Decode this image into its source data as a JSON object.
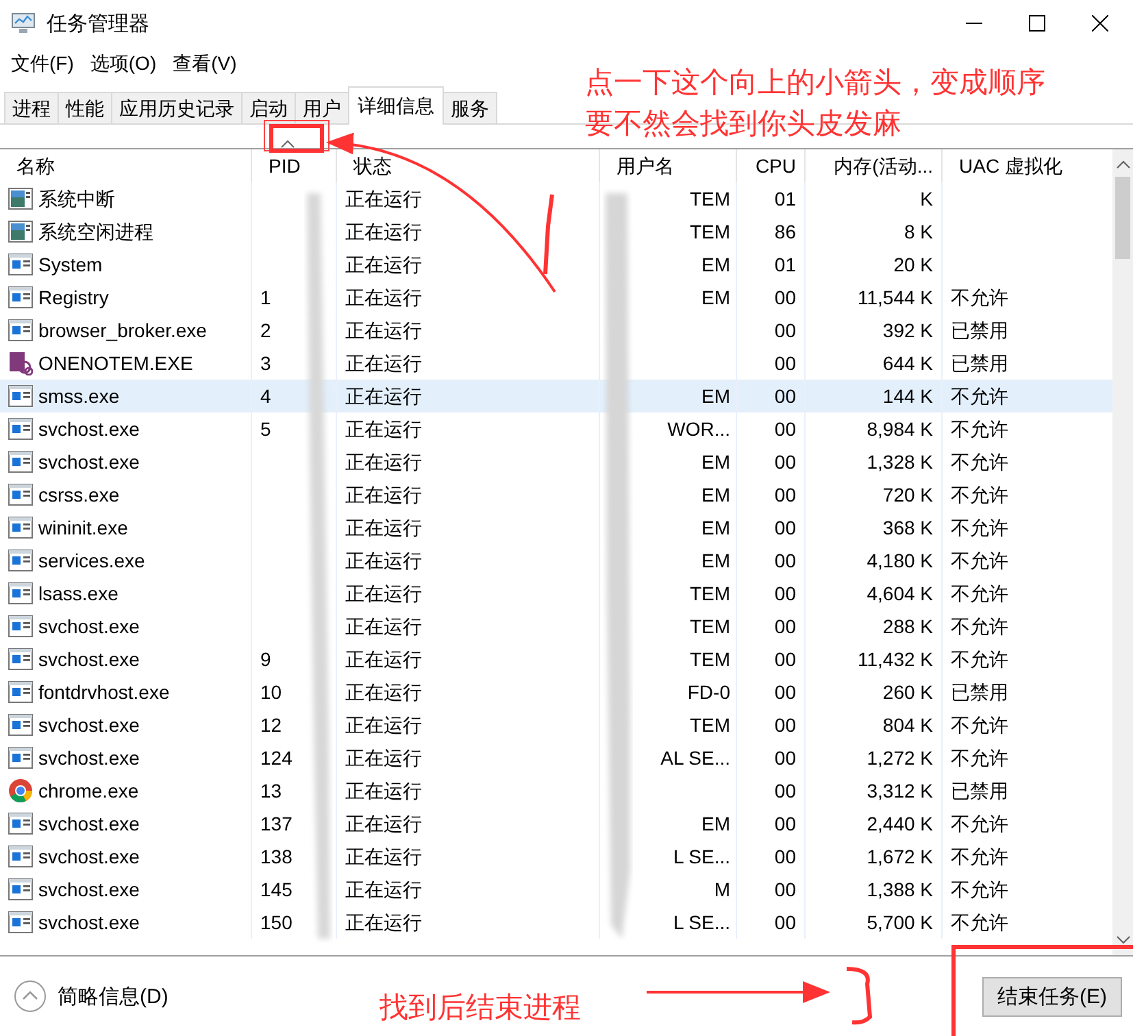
{
  "window": {
    "title": "任务管理器"
  },
  "menu": [
    "文件(F)",
    "选项(O)",
    "查看(V)"
  ],
  "tabs": [
    {
      "label": "进程",
      "selected": false
    },
    {
      "label": "性能",
      "selected": false
    },
    {
      "label": "应用历史记录",
      "selected": false
    },
    {
      "label": "启动",
      "selected": false
    },
    {
      "label": "用户",
      "selected": false
    },
    {
      "label": "详细信息",
      "selected": true
    },
    {
      "label": "服务",
      "selected": false
    }
  ],
  "table": {
    "columns": [
      {
        "label": "名称",
        "sorted": false
      },
      {
        "label": "PID",
        "sorted": true
      },
      {
        "label": "状态",
        "sorted": false
      },
      {
        "label": "用户名",
        "sorted": false
      },
      {
        "label": "CPU",
        "sorted": false
      },
      {
        "label": "内存(活动...",
        "sorted": false
      },
      {
        "label": "UAC 虚拟化",
        "sorted": false
      }
    ],
    "rows": [
      {
        "kind": "system",
        "name": "系统中断",
        "pid": "",
        "status": "正在运行",
        "user": "TEM",
        "cpu": "01",
        "memory": "K",
        "uac": "",
        "selected": false
      },
      {
        "kind": "system",
        "name": "系统空闲进程",
        "pid": "",
        "status": "正在运行",
        "user": "TEM",
        "cpu": "86",
        "memory": "8 K",
        "uac": "",
        "selected": false
      },
      {
        "kind": "window",
        "name": "System",
        "pid": "",
        "status": "正在运行",
        "user": "EM",
        "cpu": "01",
        "memory": "20 K",
        "uac": "",
        "selected": false
      },
      {
        "kind": "window",
        "name": "Registry",
        "pid": "1",
        "status": "正在运行",
        "user": "EM",
        "cpu": "00",
        "memory": "11,544 K",
        "uac": "不允许",
        "selected": false
      },
      {
        "kind": "window",
        "name": "browser_broker.exe",
        "pid": "2",
        "status": "正在运行",
        "user": "",
        "cpu": "00",
        "memory": "392 K",
        "uac": "已禁用",
        "selected": false
      },
      {
        "kind": "notebook",
        "name": "ONENOTEM.EXE",
        "pid": "3",
        "status": "正在运行",
        "user": "",
        "cpu": "00",
        "memory": "644 K",
        "uac": "已禁用",
        "selected": false
      },
      {
        "kind": "window",
        "name": "smss.exe",
        "pid": "4",
        "status": "正在运行",
        "user": "EM",
        "cpu": "00",
        "memory": "144 K",
        "uac": "不允许",
        "selected": true
      },
      {
        "kind": "window",
        "name": "svchost.exe",
        "pid": "5",
        "status": "正在运行",
        "user": "WOR...",
        "cpu": "00",
        "memory": "8,984 K",
        "uac": "不允许",
        "selected": false
      },
      {
        "kind": "window",
        "name": "svchost.exe",
        "pid": "",
        "status": "正在运行",
        "user": "EM",
        "cpu": "00",
        "memory": "1,328 K",
        "uac": "不允许",
        "selected": false
      },
      {
        "kind": "window",
        "name": "csrss.exe",
        "pid": "",
        "status": "正在运行",
        "user": "EM",
        "cpu": "00",
        "memory": "720 K",
        "uac": "不允许",
        "selected": false
      },
      {
        "kind": "window",
        "name": "wininit.exe",
        "pid": "",
        "status": "正在运行",
        "user": "EM",
        "cpu": "00",
        "memory": "368 K",
        "uac": "不允许",
        "selected": false
      },
      {
        "kind": "window",
        "name": "services.exe",
        "pid": "",
        "status": "正在运行",
        "user": "EM",
        "cpu": "00",
        "memory": "4,180 K",
        "uac": "不允许",
        "selected": false
      },
      {
        "kind": "window",
        "name": "lsass.exe",
        "pid": "",
        "status": "正在运行",
        "user": "TEM",
        "cpu": "00",
        "memory": "4,604 K",
        "uac": "不允许",
        "selected": false
      },
      {
        "kind": "window",
        "name": "svchost.exe",
        "pid": "",
        "status": "正在运行",
        "user": "TEM",
        "cpu": "00",
        "memory": "288 K",
        "uac": "不允许",
        "selected": false
      },
      {
        "kind": "window",
        "name": "svchost.exe",
        "pid": "9",
        "status": "正在运行",
        "user": "TEM",
        "cpu": "00",
        "memory": "11,432 K",
        "uac": "不允许",
        "selected": false
      },
      {
        "kind": "window",
        "name": "fontdrvhost.exe",
        "pid": "10",
        "status": "正在运行",
        "user": "FD-0",
        "cpu": "00",
        "memory": "260 K",
        "uac": "已禁用",
        "selected": false
      },
      {
        "kind": "window",
        "name": "svchost.exe",
        "pid": "12",
        "status": "正在运行",
        "user": "TEM",
        "cpu": "00",
        "memory": "804 K",
        "uac": "不允许",
        "selected": false
      },
      {
        "kind": "window",
        "name": "svchost.exe",
        "pid": "124",
        "status": "正在运行",
        "user": "AL SE...",
        "cpu": "00",
        "memory": "1,272 K",
        "uac": "不允许",
        "selected": false
      },
      {
        "kind": "browser",
        "name": "chrome.exe",
        "pid": "13",
        "status": "正在运行",
        "user": "",
        "cpu": "00",
        "memory": "3,312 K",
        "uac": "已禁用",
        "selected": false
      },
      {
        "kind": "window",
        "name": "svchost.exe",
        "pid": "137",
        "status": "正在运行",
        "user": "EM",
        "cpu": "00",
        "memory": "2,440 K",
        "uac": "不允许",
        "selected": false
      },
      {
        "kind": "window",
        "name": "svchost.exe",
        "pid": "138",
        "status": "正在运行",
        "user": "L SE...",
        "cpu": "00",
        "memory": "1,672 K",
        "uac": "不允许",
        "selected": false
      },
      {
        "kind": "window",
        "name": "svchost.exe",
        "pid": "145",
        "status": "正在运行",
        "user": "M",
        "cpu": "00",
        "memory": "1,388 K",
        "uac": "不允许",
        "selected": false
      },
      {
        "kind": "window",
        "name": "svchost.exe",
        "pid": "150",
        "status": "正在运行",
        "user": "L SE...",
        "cpu": "00",
        "memory": "5,700 K",
        "uac": "不允许",
        "selected": false
      }
    ]
  },
  "footer": {
    "details_toggle": "简略信息(D)",
    "end_task_button": "结束任务(E)"
  },
  "annotations": {
    "top_note": [
      "点一下这个向上的小箭头，变成顺序",
      "要不然会找到你头皮发麻"
    ],
    "bottom_note": "找到后结束进程"
  }
}
